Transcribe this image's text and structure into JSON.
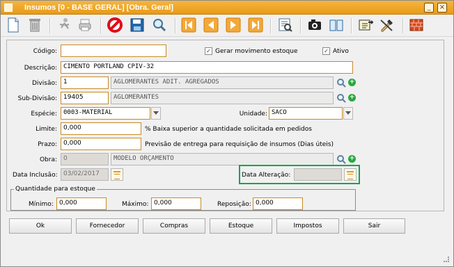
{
  "window": {
    "title": "Insumos [0 - BASE GERAL] [Obra. Geral]",
    "controls": {
      "minimize": "_",
      "close": "×"
    }
  },
  "toolbar": {
    "icons": [
      "new-document-icon",
      "delete-trash-icon",
      "run-icon",
      "print-icon",
      "cancel-icon",
      "save-icon",
      "search-icon",
      "first-record-icon",
      "previous-record-icon",
      "next-record-icon",
      "last-record-icon",
      "document-search-icon",
      "camera-icon",
      "book-icon",
      "export-icon",
      "edit-tools-icon",
      "bricks-icon"
    ]
  },
  "form": {
    "codigo_label": "Código:",
    "codigo_value": "",
    "gerar_movimento_label": "Gerar movimento estoque",
    "gerar_movimento_checked": true,
    "ativo_label": "Ativo",
    "ativo_checked": true,
    "descricao_label": "Descrição:",
    "descricao_value": "CIMENTO PORTLAND CPIV-32",
    "divisao_label": "Divisão:",
    "divisao_code": "1",
    "divisao_name": "AGLOMERANTES ADIT. AGREGADOS",
    "subdivisao_label": "Sub-Divisão:",
    "subdivisao_code": "19405",
    "subdivisao_name": "AGLOMERANTES",
    "especie_label": "Espécie:",
    "especie_value": "0003-MATERIAL",
    "unidade_label": "Unidade:",
    "unidade_value": "SACO",
    "limite_label": "Limite:",
    "limite_value": "0,000",
    "limite_hint": "% Baixa superior a quantidade solicitada em pedidos",
    "prazo_label": "Prazo:",
    "prazo_value": "0,000",
    "prazo_hint": "Previsão de entrega para requisição de insumos (Dias úteis)",
    "obra_label": "Obra:",
    "obra_code": "0",
    "obra_name": "MODELO ORÇAMENTO",
    "data_inclusao_label": "Data Inclusão:",
    "data_inclusao_value": "03/02/2017",
    "data_alteracao_label": "Data Alteração:",
    "data_alteracao_value": "",
    "quantidade_legend": "Quantidade para estoque",
    "minimo_label": "Mínimo:",
    "minimo_value": "0,000",
    "maximo_label": "Máximo:",
    "maximo_value": "0,000",
    "reposicao_label": "Reposição:",
    "reposicao_value": "0,000"
  },
  "buttons": {
    "ok": "Ok",
    "fornecedor": "Fornecedor",
    "compras": "Compras",
    "estoque": "Estoque",
    "impostos": "Impostos",
    "sair": "Sair"
  },
  "colors": {
    "title_orange": "#f0a72a",
    "field_border": "#c98b24",
    "highlight_green": "#11a54b",
    "add_green": "#27a83f"
  }
}
